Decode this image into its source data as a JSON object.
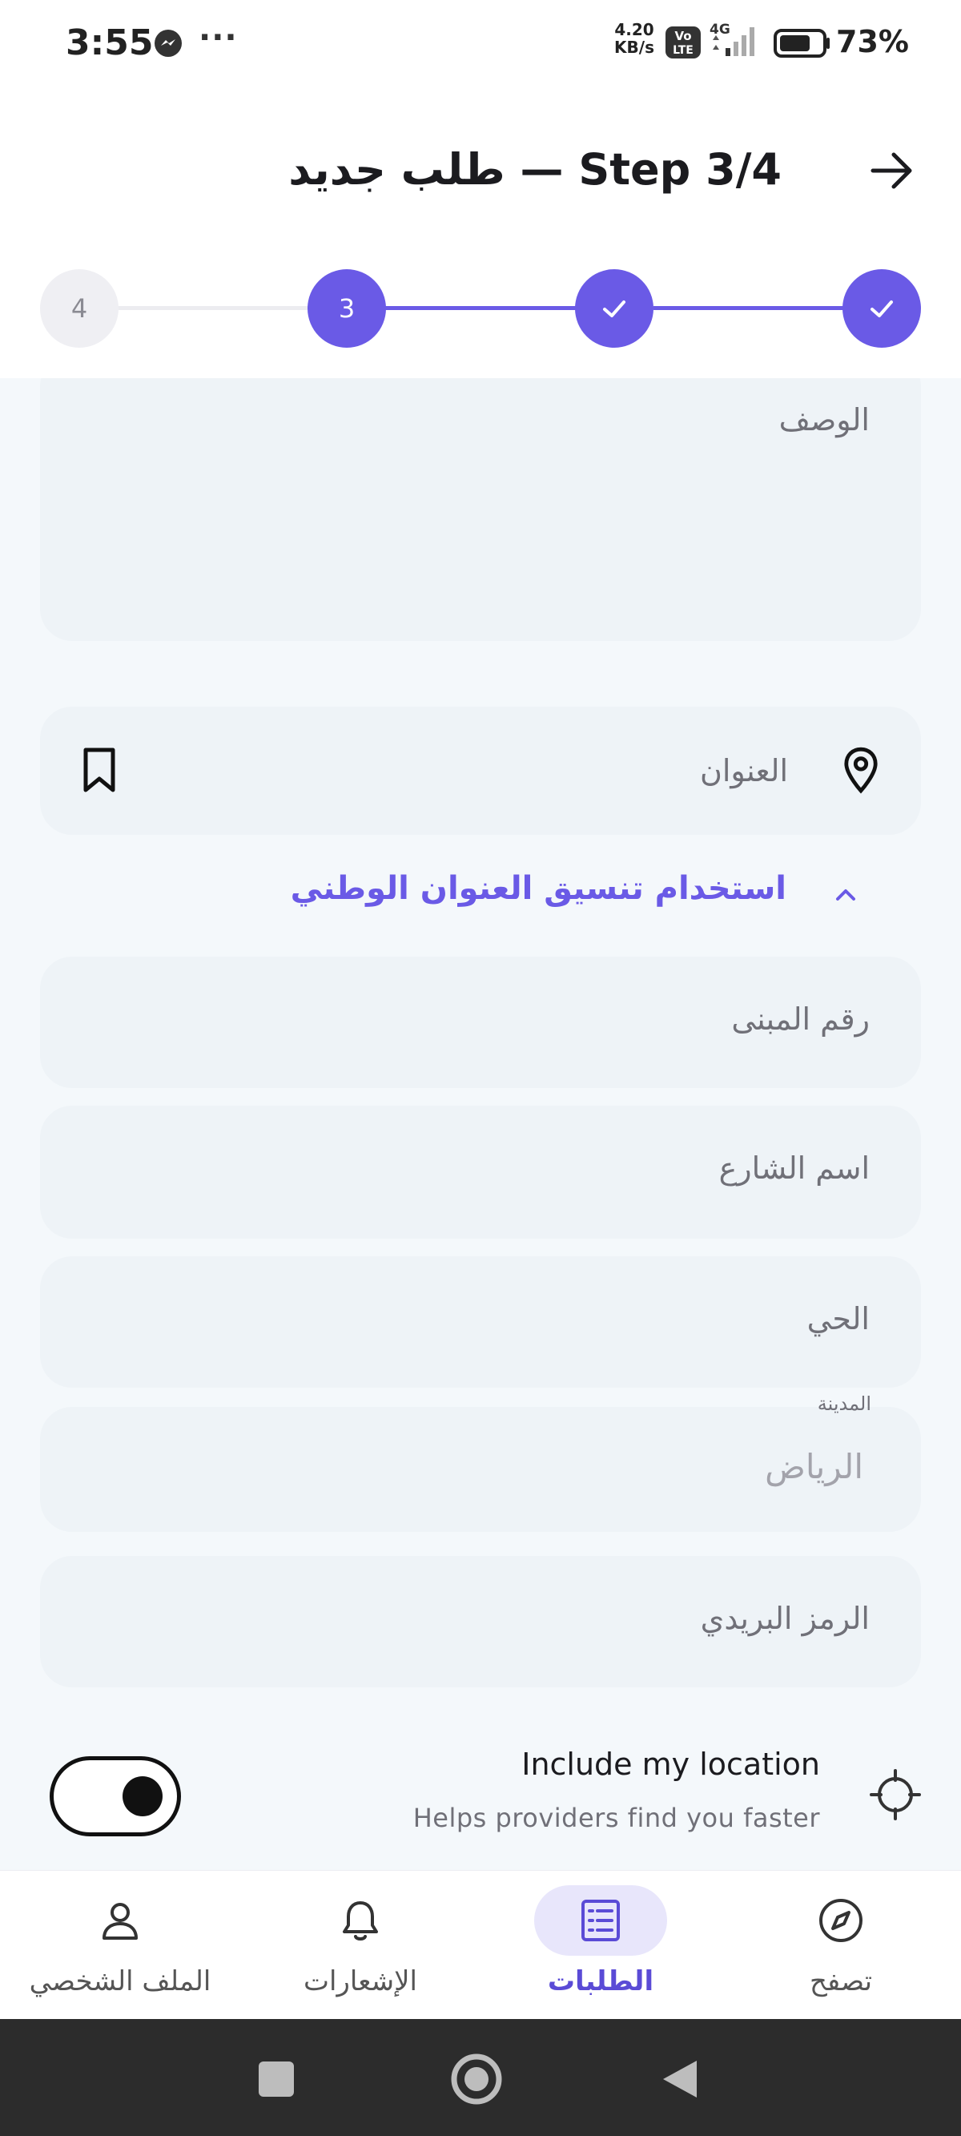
{
  "status_bar": {
    "time": "3:55",
    "more": "···",
    "net_speed_value": "4.20",
    "net_speed_unit": "KB/s",
    "volte_line1": "Vo",
    "volte_line2": "LTE",
    "network_type": "4G",
    "battery_percent": "73%",
    "battery_level": 0.73,
    "icons": [
      "messenger-icon",
      "volte-icon",
      "signal-icon",
      "battery-icon"
    ]
  },
  "header": {
    "title": "طلب جديد — Step 3/4",
    "back_icon": "arrow-right-icon"
  },
  "stepper": {
    "steps": [
      {
        "label": "",
        "state": "done"
      },
      {
        "label": "",
        "state": "done"
      },
      {
        "label": "3",
        "state": "current"
      },
      {
        "label": "4",
        "state": "todo"
      }
    ],
    "accent": "#6a5ae6"
  },
  "form": {
    "description_placeholder": "الوصف",
    "address_placeholder": "العنوان",
    "address_icons": [
      "location-pin-icon",
      "bookmark-icon"
    ],
    "national_address_toggle": "استخدام تنسيق العنوان الوطني",
    "building_number_placeholder": "رقم المبنى",
    "street_name_placeholder": "اسم الشارع",
    "district_placeholder": "الحي",
    "city_label": "المدينة",
    "city_value": "الرياض",
    "postal_code_placeholder": "الرمز البريدي",
    "include_location_title": "Include my location",
    "include_location_subtitle": "Helps providers find you faster",
    "include_location_on": true
  },
  "bottom_nav": {
    "items": [
      {
        "label": "تصفح",
        "icon": "compass-icon",
        "active": false
      },
      {
        "label": "الطلبات",
        "icon": "requests-list-icon",
        "active": true
      },
      {
        "label": "الإشعارات",
        "icon": "bell-icon",
        "active": false
      },
      {
        "label": "الملف الشخصي",
        "icon": "person-icon",
        "active": false
      }
    ]
  },
  "system_nav": {
    "icons": [
      "recents-square-icon",
      "home-circle-icon",
      "back-triangle-icon"
    ]
  }
}
